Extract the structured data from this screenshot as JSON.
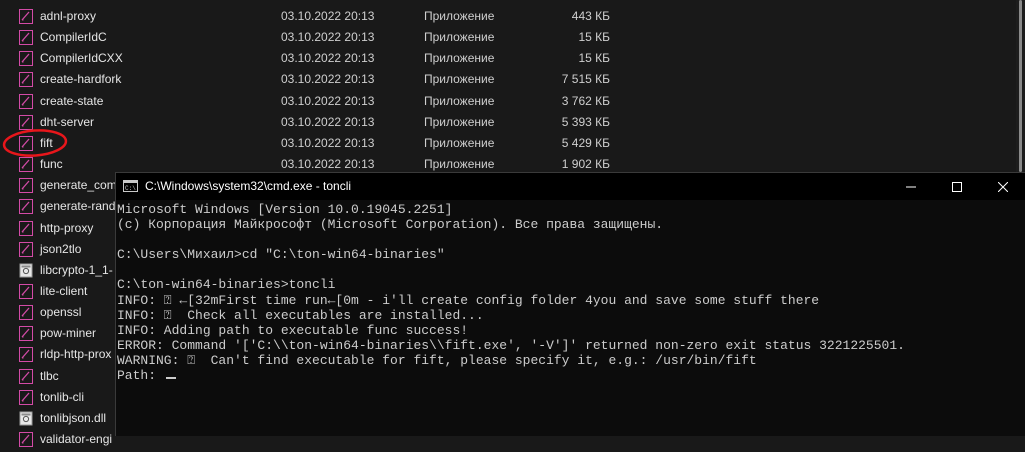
{
  "explorer": {
    "files": [
      {
        "name": "adnl-proxy",
        "date": "03.10.2022 20:13",
        "type": "Приложение",
        "size": "443 КБ",
        "icon": "app-icon"
      },
      {
        "name": "CompilerIdC",
        "date": "03.10.2022 20:13",
        "type": "Приложение",
        "size": "15 КБ",
        "icon": "app-icon"
      },
      {
        "name": "CompilerIdCXX",
        "date": "03.10.2022 20:13",
        "type": "Приложение",
        "size": "15 КБ",
        "icon": "app-icon"
      },
      {
        "name": "create-hardfork",
        "date": "03.10.2022 20:13",
        "type": "Приложение",
        "size": "7 515 КБ",
        "icon": "app-icon"
      },
      {
        "name": "create-state",
        "date": "03.10.2022 20:13",
        "type": "Приложение",
        "size": "3 762 КБ",
        "icon": "app-icon"
      },
      {
        "name": "dht-server",
        "date": "03.10.2022 20:13",
        "type": "Приложение",
        "size": "5 393 КБ",
        "icon": "app-icon"
      },
      {
        "name": "fift",
        "date": "03.10.2022 20:13",
        "type": "Приложение",
        "size": "5 429 КБ",
        "icon": "app-icon"
      },
      {
        "name": "func",
        "date": "03.10.2022 20:13",
        "type": "Приложение",
        "size": "1 902 КБ",
        "icon": "app-icon"
      },
      {
        "name": "generate_com",
        "icon": "app-icon"
      },
      {
        "name": "generate-rand",
        "icon": "app-icon"
      },
      {
        "name": "http-proxy",
        "icon": "app-icon"
      },
      {
        "name": "json2tlo",
        "icon": "app-icon"
      },
      {
        "name": "libcrypto-1_1-",
        "icon": "dll-icon"
      },
      {
        "name": "lite-client",
        "icon": "app-icon"
      },
      {
        "name": "openssl",
        "icon": "app-icon"
      },
      {
        "name": "pow-miner",
        "icon": "app-icon"
      },
      {
        "name": "rldp-http-prox",
        "icon": "app-icon"
      },
      {
        "name": "tlbc",
        "icon": "app-icon"
      },
      {
        "name": "tonlib-cli",
        "icon": "app-icon"
      },
      {
        "name": "tonlibjson.dll",
        "icon": "dll-icon"
      },
      {
        "name": "validator-engi",
        "icon": "app-icon"
      }
    ],
    "highlight_color": "#e8161b"
  },
  "console": {
    "title": "C:\\Windows\\system32\\cmd.exe - toncli",
    "lines": [
      "Microsoft Windows [Version 10.0.19045.2251]",
      "(c) Корпорация Майкрософт (Microsoft Corporation). Все права защищены.",
      "",
      "C:\\Users\\Михаил>cd \"C:\\ton-win64-binaries\"",
      "",
      "C:\\ton-win64-binaries>toncli",
      "INFO: ⍰ ←[32mFirst time run←[0m - i'll create config folder 4you and save some stuff there",
      "INFO: ⍰  Check all executables are installed...",
      "INFO: Adding path to executable func success!",
      "ERROR: Command '['C:\\\\ton-win64-binaries\\\\fift.exe', '-V']' returned non-zero exit status 3221225501.",
      "WARNING: ⍰  Can't find executable for fift, please specify it, e.g.: /usr/bin/fift",
      "Path: "
    ]
  }
}
